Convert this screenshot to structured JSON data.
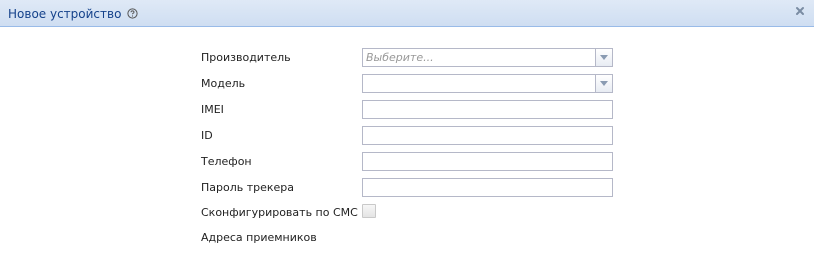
{
  "window": {
    "title": "Новое устройство",
    "help_icon": "question-circle-icon",
    "close_icon": "close-x-icon"
  },
  "form": {
    "manufacturer": {
      "label": "Производитель",
      "placeholder": "Выберите...",
      "trigger_icon": "chevron-down-icon"
    },
    "model": {
      "label": "Модель",
      "value": "",
      "trigger_icon": "chevron-down-icon"
    },
    "imei": {
      "label": "IMEI",
      "value": ""
    },
    "id": {
      "label": "ID",
      "value": ""
    },
    "phone": {
      "label": "Телефон",
      "value": ""
    },
    "tracker_password": {
      "label": "Пароль трекера",
      "value": ""
    },
    "configure_sms": {
      "label": "Сконфигурировать по СМС",
      "checked": false
    },
    "receiver_addresses": {
      "label": "Адреса приемников"
    }
  },
  "colors": {
    "titlebar_top": "#dfe9f6",
    "titlebar_bottom": "#cfdef2",
    "title_text": "#15428b",
    "field_border": "#b5b8c8",
    "placeholder_text": "#999999"
  }
}
